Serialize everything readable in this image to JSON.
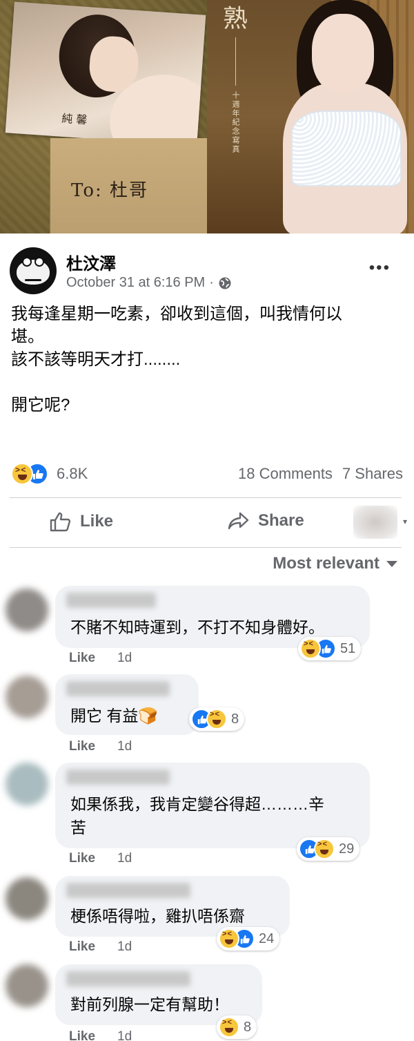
{
  "photo": {
    "left_signature": "純 馨",
    "envelope_text": "To: 杜哥",
    "right_title": "熟",
    "right_subtitle": "十週年紀念寫真"
  },
  "post": {
    "author": "杜汶澤",
    "timestamp": "October 31 at 6:16 PM",
    "separator": "·",
    "privacy_icon": "globe-icon",
    "more_icon": "more-options-icon",
    "lines": [
      "我每逢星期一吃素，卻收到這個，叫我情何以",
      "堪。",
      "該不該等明天才打........",
      "",
      "開它呢?"
    ]
  },
  "reactions": {
    "types": [
      "haha",
      "like"
    ],
    "count": "6.8K",
    "comments": "18 Comments",
    "shares": "7 Shares"
  },
  "actions": {
    "like_label": "Like",
    "share_label": "Share"
  },
  "sort": {
    "label": "Most relevant"
  },
  "comments": [
    {
      "text_lines": [
        "不賭不知時運到，不打不知身體好。"
      ],
      "like_label": "Like",
      "time": "1d",
      "reaction_types": [
        "haha",
        "like"
      ],
      "reaction_count": "51"
    },
    {
      "text_lines": [
        "開它  有益🍞"
      ],
      "like_label": "Like",
      "time": "1d",
      "reaction_types": [
        "like",
        "haha"
      ],
      "reaction_count": "8"
    },
    {
      "text_lines": [
        "如果係我，我肯定變谷得超………辛",
        "苦"
      ],
      "like_label": "Like",
      "time": "1d",
      "reaction_types": [
        "like",
        "haha"
      ],
      "reaction_count": "29"
    },
    {
      "text_lines": [
        "梗係唔得啦，雞扒唔係齋"
      ],
      "like_label": "Like",
      "time": "1d",
      "reaction_types": [
        "haha",
        "like"
      ],
      "reaction_count": "24"
    },
    {
      "text_lines": [
        "對前列腺一定有幫助！"
      ],
      "like_label": "Like",
      "time": "1d",
      "reaction_types": [
        "haha"
      ],
      "reaction_count": "8"
    }
  ],
  "colors": {
    "like_blue": "#1877f2",
    "haha_yellow": "#f7c63c",
    "secondary_text": "#65676b",
    "bubble_bg": "#f0f2f5"
  }
}
